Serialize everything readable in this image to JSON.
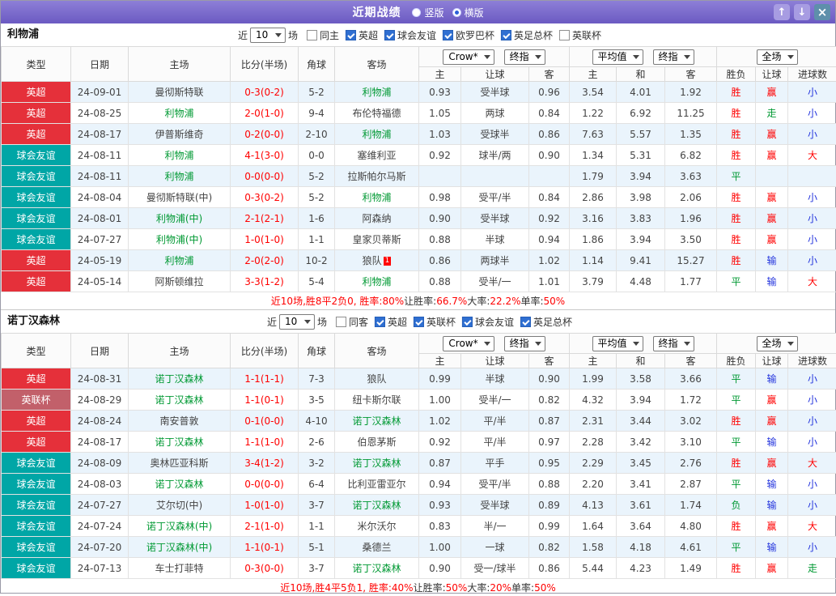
{
  "titlebar": {
    "title": "近期战绩",
    "radios": [
      {
        "label": "竖版",
        "selected": false
      },
      {
        "label": "横版",
        "selected": true
      }
    ],
    "icons": {
      "up": "↑",
      "down": "↓",
      "close": "×"
    }
  },
  "colors": {
    "league": {
      "英超": "#e5303a",
      "球会友谊": "#00a6a6",
      "英联杯": "#c2606a"
    },
    "focus_team": "#009933",
    "score": "#ff0000",
    "row_alt": "#eaf4fc",
    "result": {
      "胜": "#ff0000",
      "平": "#009933",
      "负": "#009933"
    },
    "handicap_result": {
      "赢": "#ff0000",
      "输": "#2233dd",
      "走": "#009933"
    },
    "ou_result": {
      "大": "#ff0000",
      "小": "#2233dd",
      "走": "#009933"
    }
  },
  "sections": [
    {
      "team": "利物浦",
      "filter": {
        "near": "近",
        "count": "10",
        "games": "场",
        "checkboxes": [
          {
            "label": "同主",
            "checked": false
          },
          {
            "label": "英超",
            "checked": true
          },
          {
            "label": "球会友谊",
            "checked": true
          },
          {
            "label": "欧罗巴杯",
            "checked": true
          },
          {
            "label": "英足总杯",
            "checked": true
          },
          {
            "label": "英联杯",
            "checked": false
          }
        ]
      },
      "header": {
        "cols": [
          "类型",
          "日期",
          "主场",
          "比分(半场)",
          "角球",
          "客场"
        ],
        "selects": {
          "book": "Crow*",
          "final1": "终指",
          "avg": "平均值",
          "final2": "终指",
          "scope": "全场"
        },
        "sub": [
          "主",
          "让球",
          "客",
          "主",
          "和",
          "客",
          "胜负",
          "让球",
          "进球数"
        ]
      },
      "rows": [
        {
          "league": "英超",
          "date": "24-09-01",
          "home": "曼彻斯特联",
          "home_focus": false,
          "score": "0-3(0-2)",
          "corner": "5-2",
          "away": "利物浦",
          "away_focus": true,
          "ah_home": "0.93",
          "ah_line": "受半球",
          "ah_away": "0.96",
          "eu_home": "3.54",
          "eu_draw": "4.01",
          "eu_away": "1.92",
          "result": "胜",
          "ah_result": "赢",
          "ou_result": "小"
        },
        {
          "league": "英超",
          "date": "24-08-25",
          "home": "利物浦",
          "home_focus": true,
          "score": "2-0(1-0)",
          "corner": "9-4",
          "away": "布伦特福德",
          "away_focus": false,
          "ah_home": "1.05",
          "ah_line": "两球",
          "ah_away": "0.84",
          "eu_home": "1.22",
          "eu_draw": "6.92",
          "eu_away": "11.25",
          "result": "胜",
          "ah_result": "走",
          "ou_result": "小"
        },
        {
          "league": "英超",
          "date": "24-08-17",
          "home": "伊普斯维奇",
          "home_focus": false,
          "score": "0-2(0-0)",
          "corner": "2-10",
          "away": "利物浦",
          "away_focus": true,
          "ah_home": "1.03",
          "ah_line": "受球半",
          "ah_away": "0.86",
          "eu_home": "7.63",
          "eu_draw": "5.57",
          "eu_away": "1.35",
          "result": "胜",
          "ah_result": "赢",
          "ou_result": "小"
        },
        {
          "league": "球会友谊",
          "date": "24-08-11",
          "home": "利物浦",
          "home_focus": true,
          "score": "4-1(3-0)",
          "corner": "0-0",
          "away": "塞维利亚",
          "away_focus": false,
          "ah_home": "0.92",
          "ah_line": "球半/两",
          "ah_away": "0.90",
          "eu_home": "1.34",
          "eu_draw": "5.31",
          "eu_away": "6.82",
          "result": "胜",
          "ah_result": "赢",
          "ou_result": "大"
        },
        {
          "league": "球会友谊",
          "date": "24-08-11",
          "home": "利物浦",
          "home_focus": true,
          "score": "0-0(0-0)",
          "corner": "5-2",
          "away": "拉斯帕尔马斯",
          "away_focus": false,
          "ah_home": "",
          "ah_line": "",
          "ah_away": "",
          "eu_home": "1.79",
          "eu_draw": "3.94",
          "eu_away": "3.63",
          "result": "平",
          "ah_result": "",
          "ou_result": ""
        },
        {
          "league": "球会友谊",
          "date": "24-08-04",
          "home": "曼彻斯特联(中)",
          "home_focus": false,
          "score": "0-3(0-2)",
          "corner": "5-2",
          "away": "利物浦",
          "away_focus": true,
          "ah_home": "0.98",
          "ah_line": "受平/半",
          "ah_away": "0.84",
          "eu_home": "2.86",
          "eu_draw": "3.98",
          "eu_away": "2.06",
          "result": "胜",
          "ah_result": "赢",
          "ou_result": "小"
        },
        {
          "league": "球会友谊",
          "date": "24-08-01",
          "home": "利物浦(中)",
          "home_focus": true,
          "score": "2-1(2-1)",
          "corner": "1-6",
          "away": "阿森纳",
          "away_focus": false,
          "ah_home": "0.90",
          "ah_line": "受半球",
          "ah_away": "0.92",
          "eu_home": "3.16",
          "eu_draw": "3.83",
          "eu_away": "1.96",
          "result": "胜",
          "ah_result": "赢",
          "ou_result": "小"
        },
        {
          "league": "球会友谊",
          "date": "24-07-27",
          "home": "利物浦(中)",
          "home_focus": true,
          "score": "1-0(1-0)",
          "corner": "1-1",
          "away": "皇家贝蒂斯",
          "away_focus": false,
          "ah_home": "0.88",
          "ah_line": "半球",
          "ah_away": "0.94",
          "eu_home": "1.86",
          "eu_draw": "3.94",
          "eu_away": "3.50",
          "result": "胜",
          "ah_result": "赢",
          "ou_result": "小"
        },
        {
          "league": "英超",
          "date": "24-05-19",
          "home": "利物浦",
          "home_focus": true,
          "score": "2-0(2-0)",
          "corner": "10-2",
          "away": "狼队",
          "away_sup": "1",
          "away_focus": false,
          "ah_home": "0.86",
          "ah_line": "两球半",
          "ah_away": "1.02",
          "eu_home": "1.14",
          "eu_draw": "9.41",
          "eu_away": "15.27",
          "result": "胜",
          "ah_result": "输",
          "ou_result": "小"
        },
        {
          "league": "英超",
          "date": "24-05-14",
          "home": "阿斯顿维拉",
          "home_focus": false,
          "score": "3-3(1-2)",
          "corner": "5-4",
          "away": "利物浦",
          "away_focus": true,
          "ah_home": "0.88",
          "ah_line": "受半/一",
          "ah_away": "1.01",
          "eu_home": "3.79",
          "eu_draw": "4.48",
          "eu_away": "1.77",
          "result": "平",
          "ah_result": "输",
          "ou_result": "大"
        }
      ],
      "summary": [
        {
          "text": "近10场,胜8平2负0, 胜率:80%",
          "color": "red"
        },
        {
          "text": " 让胜率:",
          "color": "dark"
        },
        {
          "text": "66.7%",
          "color": "red"
        },
        {
          "text": " 大率:",
          "color": "dark"
        },
        {
          "text": "22.2%",
          "color": "red"
        },
        {
          "text": " 单率:",
          "color": "dark"
        },
        {
          "text": "50%",
          "color": "red"
        }
      ]
    },
    {
      "team": "诺丁汉森林",
      "filter": {
        "near": "近",
        "count": "10",
        "games": "场",
        "checkboxes": [
          {
            "label": "同客",
            "checked": false
          },
          {
            "label": "英超",
            "checked": true
          },
          {
            "label": "英联杯",
            "checked": true
          },
          {
            "label": "球会友谊",
            "checked": true
          },
          {
            "label": "英足总杯",
            "checked": true
          }
        ]
      },
      "header": {
        "cols": [
          "类型",
          "日期",
          "主场",
          "比分(半场)",
          "角球",
          "客场"
        ],
        "selects": {
          "book": "Crow*",
          "final1": "终指",
          "avg": "平均值",
          "final2": "终指",
          "scope": "全场"
        },
        "sub": [
          "主",
          "让球",
          "客",
          "主",
          "和",
          "客",
          "胜负",
          "让球",
          "进球数"
        ]
      },
      "rows": [
        {
          "league": "英超",
          "date": "24-08-31",
          "home": "诺丁汉森林",
          "home_focus": true,
          "score": "1-1(1-1)",
          "corner": "7-3",
          "away": "狼队",
          "away_focus": false,
          "ah_home": "0.99",
          "ah_line": "半球",
          "ah_away": "0.90",
          "eu_home": "1.99",
          "eu_draw": "3.58",
          "eu_away": "3.66",
          "result": "平",
          "ah_result": "输",
          "ou_result": "小"
        },
        {
          "league": "英联杯",
          "date": "24-08-29",
          "home": "诺丁汉森林",
          "home_focus": true,
          "score": "1-1(0-1)",
          "corner": "3-5",
          "away": "纽卡斯尔联",
          "away_focus": false,
          "ah_home": "1.00",
          "ah_line": "受半/一",
          "ah_away": "0.82",
          "eu_home": "4.32",
          "eu_draw": "3.94",
          "eu_away": "1.72",
          "result": "平",
          "ah_result": "赢",
          "ou_result": "小"
        },
        {
          "league": "英超",
          "date": "24-08-24",
          "home": "南安普敦",
          "home_focus": false,
          "score": "0-1(0-0)",
          "corner": "4-10",
          "away": "诺丁汉森林",
          "away_focus": true,
          "ah_home": "1.02",
          "ah_line": "平/半",
          "ah_away": "0.87",
          "eu_home": "2.31",
          "eu_draw": "3.44",
          "eu_away": "3.02",
          "result": "胜",
          "ah_result": "赢",
          "ou_result": "小"
        },
        {
          "league": "英超",
          "date": "24-08-17",
          "home": "诺丁汉森林",
          "home_focus": true,
          "score": "1-1(1-0)",
          "corner": "2-6",
          "away": "伯恩茅斯",
          "away_focus": false,
          "ah_home": "0.92",
          "ah_line": "平/半",
          "ah_away": "0.97",
          "eu_home": "2.28",
          "eu_draw": "3.42",
          "eu_away": "3.10",
          "result": "平",
          "ah_result": "输",
          "ou_result": "小"
        },
        {
          "league": "球会友谊",
          "date": "24-08-09",
          "home": "奥林匹亚科斯",
          "home_focus": false,
          "score": "3-4(1-2)",
          "corner": "3-2",
          "away": "诺丁汉森林",
          "away_focus": true,
          "ah_home": "0.87",
          "ah_line": "平手",
          "ah_away": "0.95",
          "eu_home": "2.29",
          "eu_draw": "3.45",
          "eu_away": "2.76",
          "result": "胜",
          "ah_result": "赢",
          "ou_result": "大"
        },
        {
          "league": "球会友谊",
          "date": "24-08-03",
          "home": "诺丁汉森林",
          "home_focus": true,
          "score": "0-0(0-0)",
          "corner": "6-4",
          "away": "比利亚雷亚尔",
          "away_focus": false,
          "ah_home": "0.94",
          "ah_line": "受平/半",
          "ah_away": "0.88",
          "eu_home": "2.20",
          "eu_draw": "3.41",
          "eu_away": "2.87",
          "result": "平",
          "ah_result": "输",
          "ou_result": "小"
        },
        {
          "league": "球会友谊",
          "date": "24-07-27",
          "home": "艾尔切(中)",
          "home_focus": false,
          "score": "1-0(1-0)",
          "corner": "3-7",
          "away": "诺丁汉森林",
          "away_focus": true,
          "ah_home": "0.93",
          "ah_line": "受半球",
          "ah_away": "0.89",
          "eu_home": "4.13",
          "eu_draw": "3.61",
          "eu_away": "1.74",
          "result": "负",
          "ah_result": "输",
          "ou_result": "小"
        },
        {
          "league": "球会友谊",
          "date": "24-07-24",
          "home": "诺丁汉森林(中)",
          "home_focus": true,
          "score": "2-1(1-0)",
          "corner": "1-1",
          "away": "米尔沃尔",
          "away_focus": false,
          "ah_home": "0.83",
          "ah_line": "半/一",
          "ah_away": "0.99",
          "eu_home": "1.64",
          "eu_draw": "3.64",
          "eu_away": "4.80",
          "result": "胜",
          "ah_result": "赢",
          "ou_result": "大"
        },
        {
          "league": "球会友谊",
          "date": "24-07-20",
          "home": "诺丁汉森林(中)",
          "home_focus": true,
          "score": "1-1(0-1)",
          "corner": "5-1",
          "away": "桑德兰",
          "away_focus": false,
          "ah_home": "1.00",
          "ah_line": "一球",
          "ah_away": "0.82",
          "eu_home": "1.58",
          "eu_draw": "4.18",
          "eu_away": "4.61",
          "result": "平",
          "ah_result": "输",
          "ou_result": "小"
        },
        {
          "league": "球会友谊",
          "date": "24-07-13",
          "home": "车士打菲特",
          "home_focus": false,
          "score": "0-3(0-0)",
          "corner": "3-7",
          "away": "诺丁汉森林",
          "away_focus": true,
          "ah_home": "0.90",
          "ah_line": "受一/球半",
          "ah_away": "0.86",
          "eu_home": "5.44",
          "eu_draw": "4.23",
          "eu_away": "1.49",
          "result": "胜",
          "ah_result": "赢",
          "ou_result": "走"
        }
      ],
      "summary": [
        {
          "text": "近10场,胜4平5负1, 胜率:40%",
          "color": "red"
        },
        {
          "text": " 让胜率:",
          "color": "dark"
        },
        {
          "text": "50%",
          "color": "red"
        },
        {
          "text": " 大率:",
          "color": "dark"
        },
        {
          "text": "20%",
          "color": "red"
        },
        {
          "text": " 单率:",
          "color": "dark"
        },
        {
          "text": "50%",
          "color": "red"
        }
      ]
    }
  ]
}
